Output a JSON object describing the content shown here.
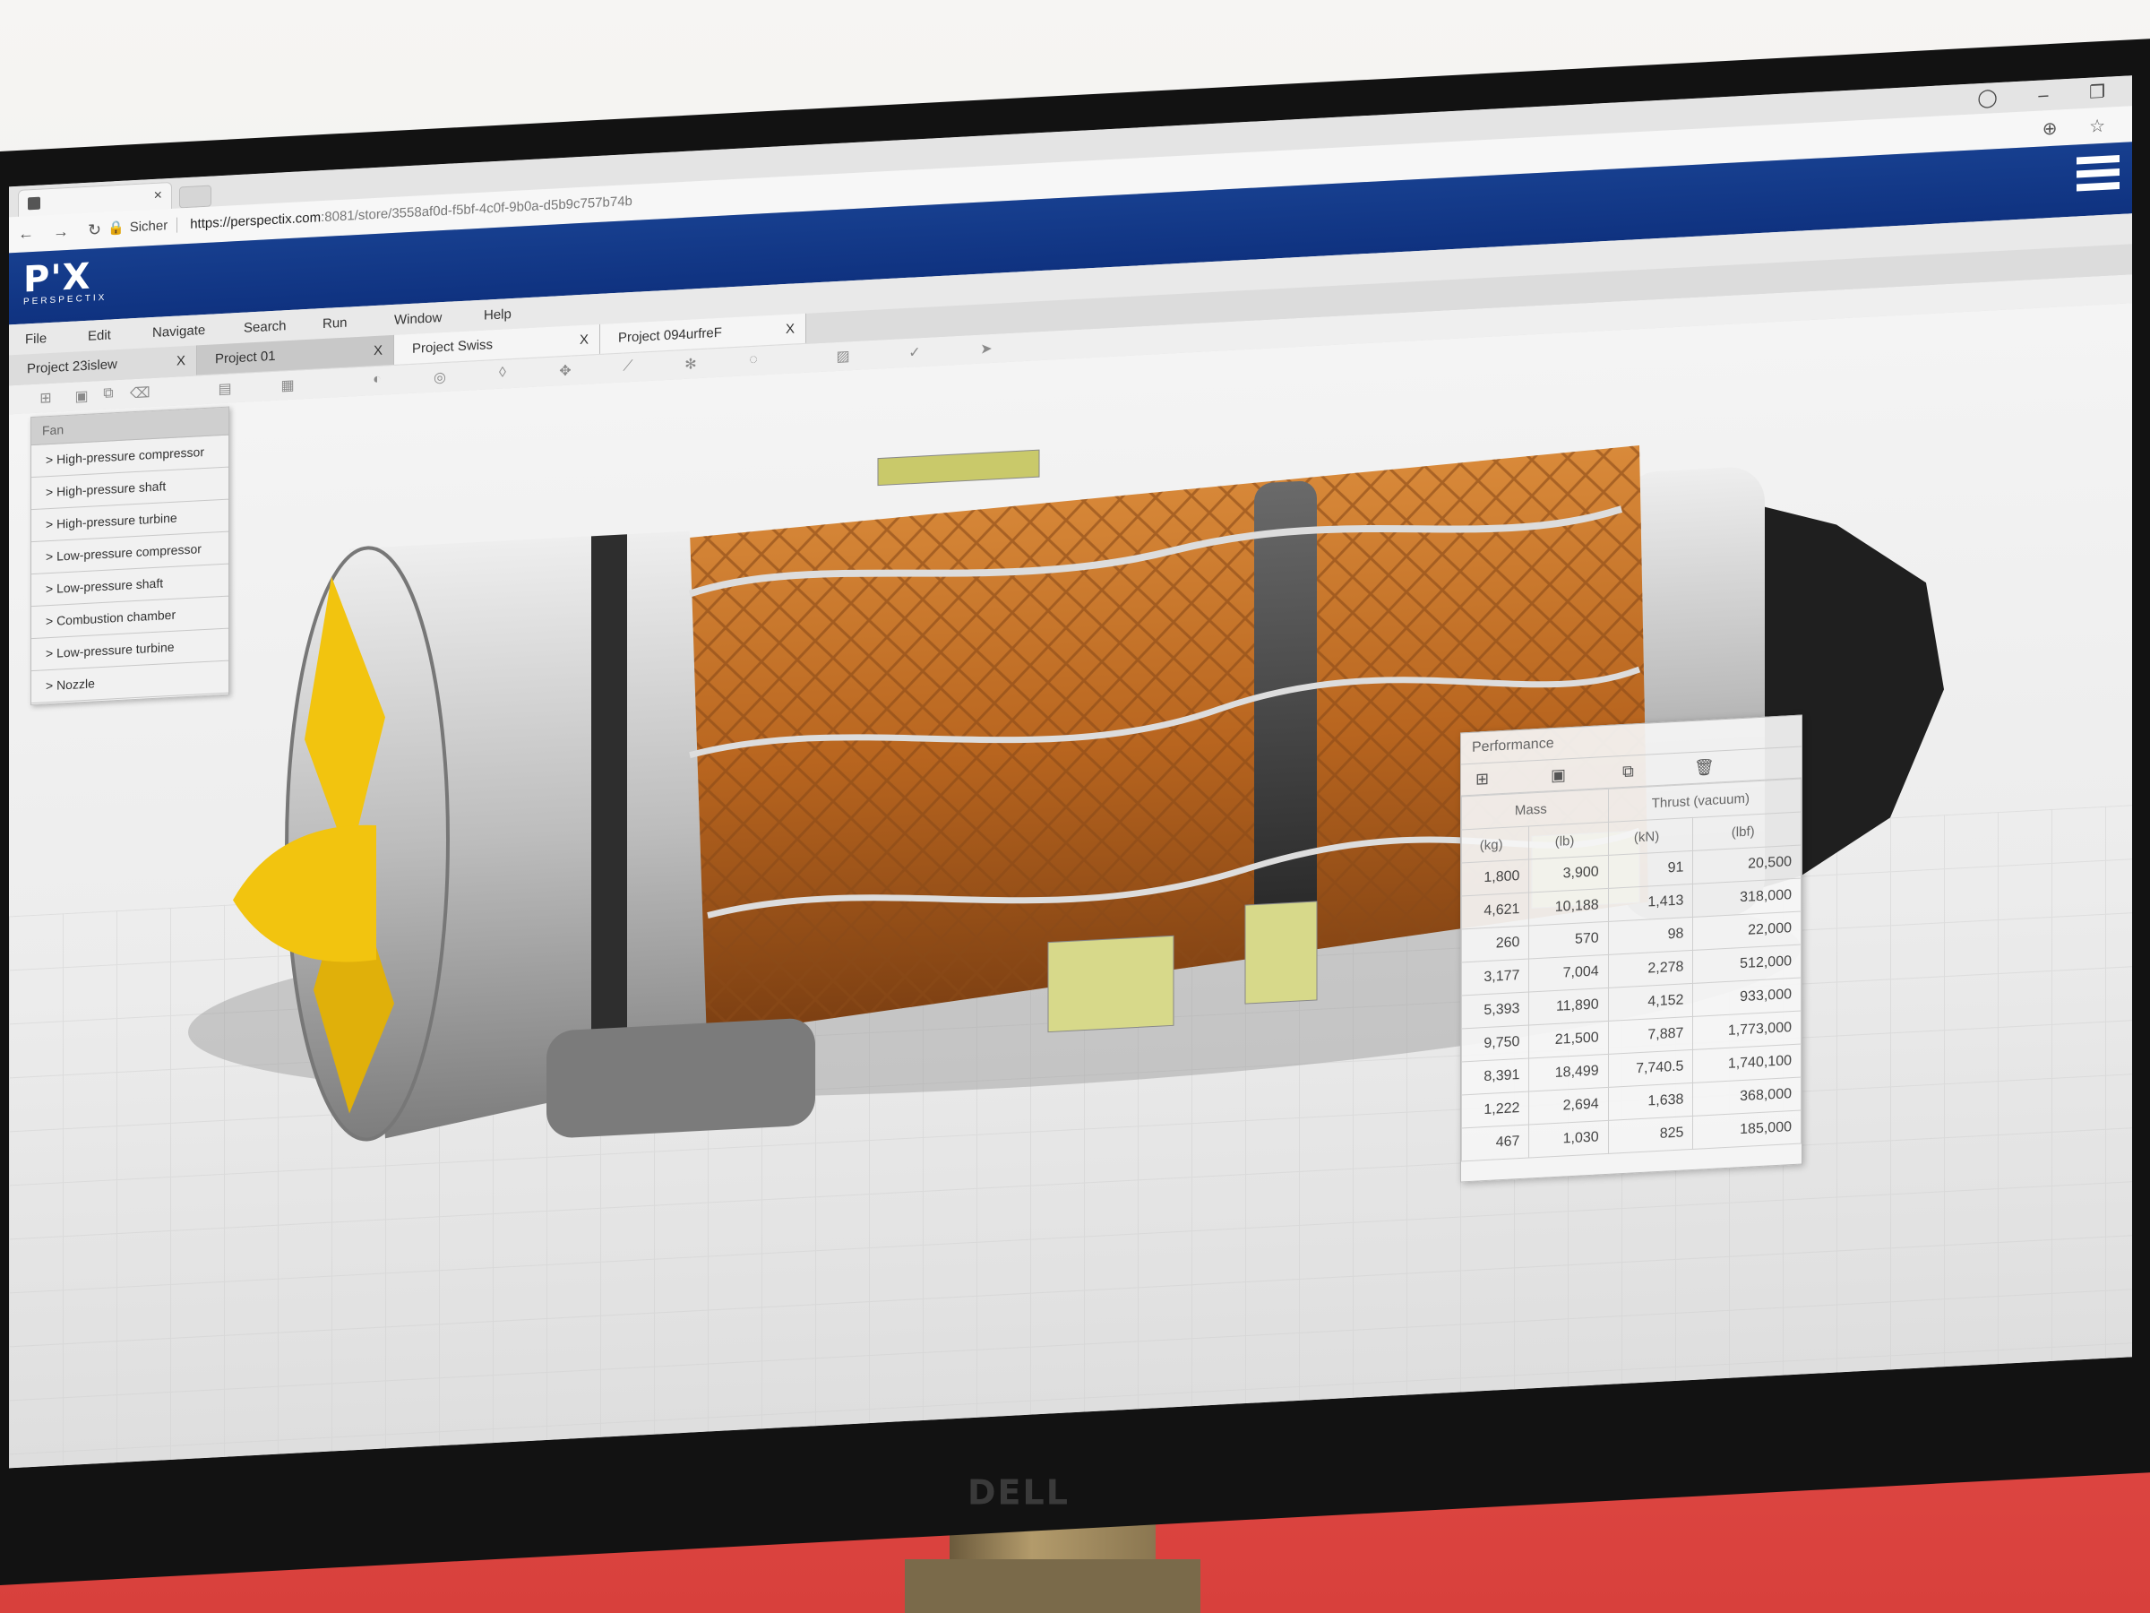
{
  "browser": {
    "tab_icon": "document-icon",
    "tab_close": "×",
    "url_lock": "🔒",
    "url_secure": "Sicher",
    "url_host": "https://perspectix.com",
    "url_path": ":8081/store/3558af0d-f5bf-4c0f-9b0a-d5b9c757b74b"
  },
  "app": {
    "logo": "P'X",
    "logo_sub": "PERSPECTIX"
  },
  "menu": {
    "items": [
      "File",
      "Edit",
      "Navigate",
      "Search",
      "Run",
      "Window",
      "Help"
    ]
  },
  "project_tabs": [
    {
      "label": "Project 23islew",
      "close": "X"
    },
    {
      "label": "Project 01",
      "close": "X"
    },
    {
      "label": "Project Swiss",
      "close": "X"
    },
    {
      "label": "Project 094urfreF",
      "close": "X"
    }
  ],
  "tree": {
    "root": "Fan",
    "items": [
      "> High-pressure compressor",
      "> High-pressure shaft",
      "> High-pressure turbine",
      "> Low-pressure compressor",
      "> Low-pressure shaft",
      "> Combustion chamber",
      "> Low-pressure turbine",
      "> Nozzle"
    ]
  },
  "performance": {
    "title": "Performance",
    "group_headers": [
      "Mass",
      "Thrust (vacuum)"
    ],
    "unit_headers": [
      "(kg)",
      "(lb)",
      "(kN)",
      "(lbf)"
    ],
    "rows": [
      [
        "1,800",
        "3,900",
        "91",
        "20,500"
      ],
      [
        "4,621",
        "10,188",
        "1,413",
        "318,000"
      ],
      [
        "260",
        "570",
        "98",
        "22,000"
      ],
      [
        "3,177",
        "7,004",
        "2,278",
        "512,000"
      ],
      [
        "5,393",
        "11,890",
        "4,152",
        "933,000"
      ],
      [
        "9,750",
        "21,500",
        "7,887",
        "1,773,000"
      ],
      [
        "8,391",
        "18,499",
        "7,740.5",
        "1,740,100"
      ],
      [
        "1,222",
        "2,694",
        "1,638",
        "368,000"
      ],
      [
        "467",
        "1,030",
        "825",
        "185,000"
      ]
    ]
  },
  "monitor": {
    "brand": "DELL"
  },
  "colors": {
    "header_blue": "#0f3280",
    "engine_copper": "#b8651f",
    "fan_yellow": "#f2c40f",
    "floor_red": "#d93a38"
  }
}
